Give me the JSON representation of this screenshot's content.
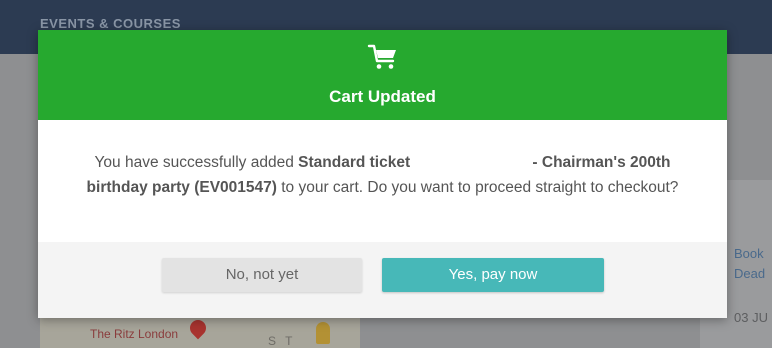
{
  "background": {
    "header_title": "EVENTS & COURSES",
    "map_label": "The Ritz London",
    "street_label": "S T",
    "ticket_label": "Standard ticket",
    "right_column": [
      "Book",
      "Dead",
      "03 JU"
    ]
  },
  "modal": {
    "icon": "cart-icon",
    "title": "Cart Updated",
    "message": {
      "prefix": "You have successfully added ",
      "ticket": "Standard ticket",
      "event_dash": " - Chairman's 200th birthday party (EV001547)",
      "suffix": " to your cart. Do you want to proceed straight to checkout?"
    },
    "buttons": {
      "no_label": "No, not yet",
      "yes_label": "Yes, pay now"
    }
  },
  "colors": {
    "header_green": "#26a92f",
    "primary_teal": "#47b8b8",
    "secondary_grey": "#e3e3e3",
    "page_header_navy": "#2c3b52"
  }
}
